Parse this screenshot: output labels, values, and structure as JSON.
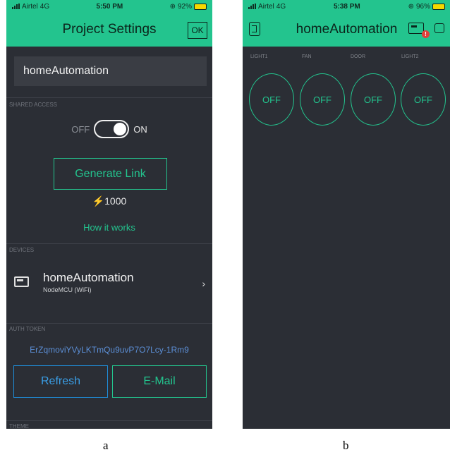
{
  "screen_a": {
    "status": {
      "carrier": "Airtel",
      "network": "4G",
      "time": "5:50 PM",
      "battery": "92%"
    },
    "title": "Project Settings",
    "ok_label": "OK",
    "project_name": "homeAutomation",
    "shared_access": {
      "label": "SHARED ACCESS",
      "off_label": "OFF",
      "on_label": "ON",
      "state": "on"
    },
    "generate_link_label": "Generate Link",
    "energy": "⚡1000",
    "how_it_works": "How it works",
    "devices": {
      "label": "DEVICES",
      "items": [
        {
          "name": "homeAutomation",
          "type": "NodeMCU (WiFi)"
        }
      ]
    },
    "auth_token": {
      "label": "AUTH TOKEN",
      "value": "ErZqmoviYVyLKTmQu9uvP7O7Lcy-1Rm9"
    },
    "refresh_label": "Refresh",
    "email_label": "E-Mail",
    "theme_label": "THEME",
    "caption": "a"
  },
  "screen_b": {
    "status": {
      "carrier": "Airtel",
      "network": "4G",
      "time": "5:38 PM",
      "battery": "96%"
    },
    "title": "homeAutomation",
    "alert_badge": "!",
    "buttons": [
      {
        "label": "LIGHT1",
        "state": "OFF"
      },
      {
        "label": "FAN",
        "state": "OFF"
      },
      {
        "label": "DOOR",
        "state": "OFF"
      },
      {
        "label": "LIGHT2",
        "state": "OFF"
      }
    ],
    "caption": "b"
  },
  "colors": {
    "accent": "#23c48e",
    "background": "#2b2e35",
    "link_blue": "#5c8fd6",
    "refresh_blue": "#1f8bd6"
  }
}
